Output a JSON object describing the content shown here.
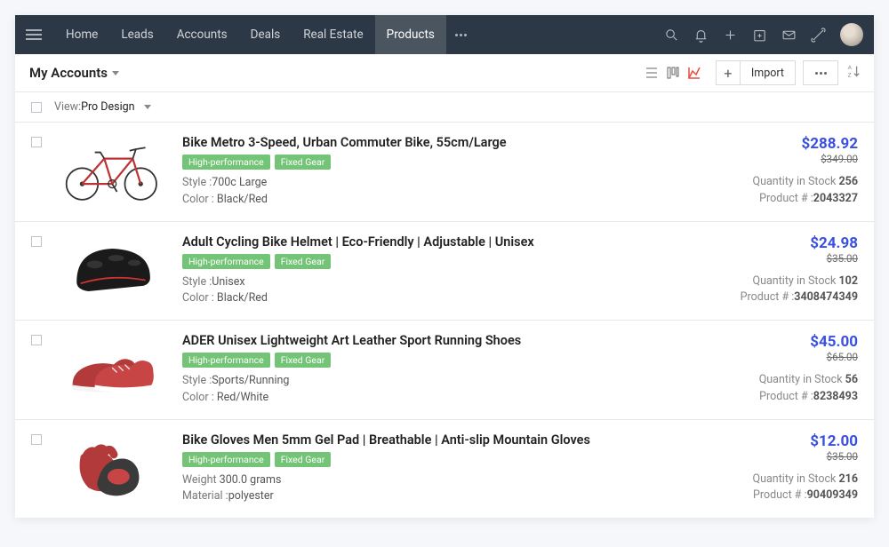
{
  "nav": {
    "items": [
      "Home",
      "Leads",
      "Accounts",
      "Deals",
      "Real Estate",
      "Products"
    ],
    "activeIndex": 5
  },
  "subheader": {
    "title": "My Accounts",
    "importLabel": "Import"
  },
  "view": {
    "label": "View:",
    "value": "Pro Design"
  },
  "tags": [
    "High-performance",
    "Fixed Gear"
  ],
  "products": [
    {
      "title": "Bike Metro 3-Speed, Urban Commuter Bike, 55cm/Large",
      "attr1_key": "Style :",
      "attr1_val": "700c Large",
      "attr2_key": "Color : ",
      "attr2_val": "Black/Red",
      "price": "$288.92",
      "oldPrice": "$349.00",
      "stock_key": "Quantity in Stock ",
      "stock_val": "256",
      "prod_key": "Product # :",
      "prod_val": "2043327"
    },
    {
      "title": "Adult Cycling Bike Helmet | Eco-Friendly | Adjustable | Unisex",
      "attr1_key": "Style :",
      "attr1_val": "Unisex",
      "attr2_key": "Color : ",
      "attr2_val": "Black/Red",
      "price": "$24.98",
      "oldPrice": "$35.00",
      "stock_key": "Quantity in Stock ",
      "stock_val": "102",
      "prod_key": "Product # :",
      "prod_val": "3408474349"
    },
    {
      "title": "ADER Unisex Lightweight Art Leather Sport Running Shoes",
      "attr1_key": "Style :",
      "attr1_val": "Sports/Running",
      "attr2_key": "Color : ",
      "attr2_val": "Red/White",
      "price": "$45.00",
      "oldPrice": "$65.00",
      "stock_key": "Quantity in Stock ",
      "stock_val": "56",
      "prod_key": "Product # :",
      "prod_val": "8238493"
    },
    {
      "title": "Bike Gloves Men 5mm Gel Pad | Breathable | Anti-slip Mountain Gloves",
      "attr1_key": "Weight ",
      "attr1_val": "300.0 grams",
      "attr2_key": "Material :",
      "attr2_val": "polyester",
      "price": "$12.00",
      "oldPrice": "$35.00",
      "stock_key": "Quantity in Stock ",
      "stock_val": "216",
      "prod_key": "Product # :",
      "prod_val": "90409349"
    }
  ]
}
